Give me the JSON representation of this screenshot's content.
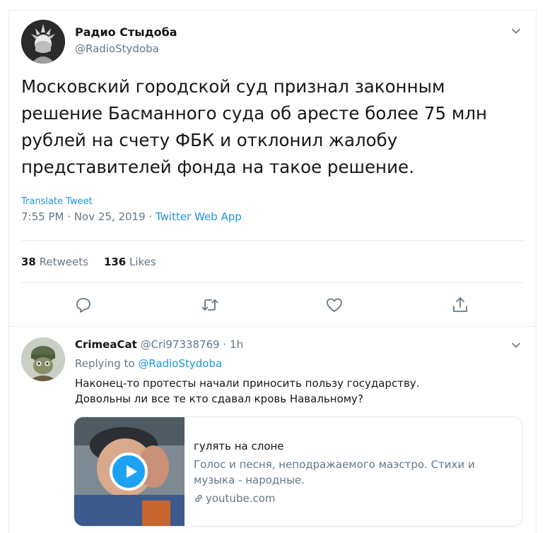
{
  "tweet": {
    "author_name": "Радио Стыдоба",
    "author_handle": "@RadioStydoba",
    "text": "Московский городской суд признал законным решение Басманного суда об аресте более 75 млн рублей на счету ФБК и отклонил жалобу представителей фонда на такое решение.",
    "translate_label": "Translate Tweet",
    "time": "7:55 PM",
    "date": "Nov 25, 2019",
    "separator": "·",
    "source_app": "Twitter Web App",
    "retweets_count": "38",
    "retweets_label": "Retweets",
    "likes_count": "136",
    "likes_label": "Likes",
    "actions": [
      "reply-icon",
      "retweet-icon",
      "like-icon",
      "share-icon"
    ]
  },
  "reply": {
    "author_name": "CrimeaCat",
    "author_handle": "@Cri97338769",
    "separator": "·",
    "time_ago": "1h",
    "replying_prefix": "Replying to",
    "replying_to": "@RadioStydoba",
    "text_line1": "Наконец-то протесты начали приносить пользу государству.",
    "text_line2": "Довольны ли все те кто сдавал кровь Навальному?",
    "card": {
      "title": "гулять на слоне",
      "description": "Голос и песня, неподражаемого маэстро. Стихи и музыка - народные.",
      "domain": "youtube.com",
      "icon": "link-icon",
      "media_icon": "play-icon"
    }
  },
  "colors": {
    "accent": "#1da1f2",
    "link": "#1b95e0",
    "text": "#14171a",
    "secondary": "#657786",
    "border": "#e6ecf0"
  }
}
